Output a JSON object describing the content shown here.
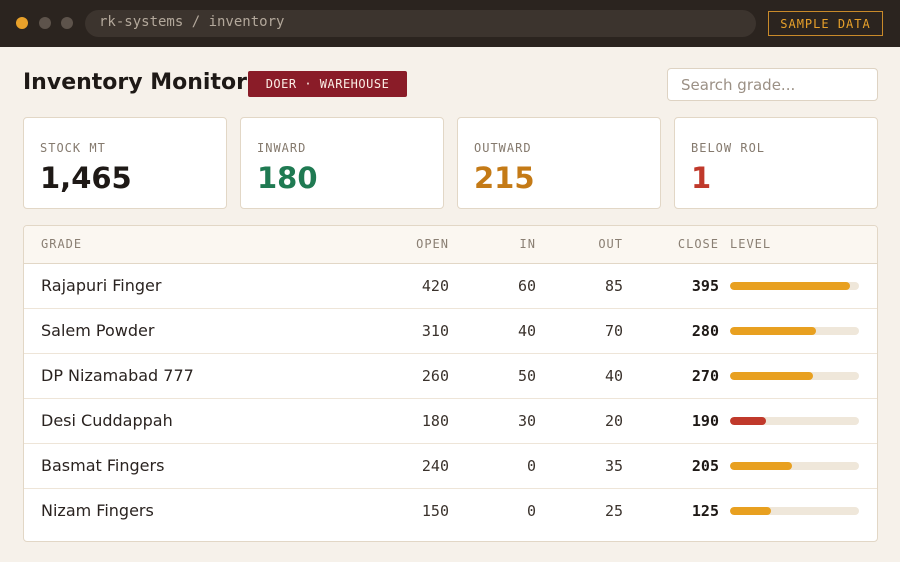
{
  "browser": {
    "address": "rk-systems / inventory",
    "sample_label": "SAMPLE DATA"
  },
  "header": {
    "title": "Inventory Monitor",
    "badge": "DOER · WAREHOUSE",
    "search_placeholder": "Search grade..."
  },
  "stats": [
    {
      "label": "STOCK MT",
      "value": "1,465",
      "color": "#1e1916"
    },
    {
      "label": "INWARD",
      "value": "180",
      "color": "#1f7a52"
    },
    {
      "label": "OUTWARD",
      "value": "215",
      "color": "#c47a16"
    },
    {
      "label": "BELOW ROL",
      "value": "1",
      "color": "#c0392b"
    }
  ],
  "table": {
    "columns": {
      "grade": "GRADE",
      "open": "OPEN",
      "in": "IN",
      "out": "OUT",
      "close": "CLOSE",
      "level": "LEVEL"
    },
    "colors": {
      "normal": "#e8a020",
      "low": "#c0392b"
    },
    "rows": [
      {
        "grade": "Rajapuri Finger",
        "open": "420",
        "in": "60",
        "out": "85",
        "close": "395",
        "level": 0.93,
        "low": false
      },
      {
        "grade": "Salem Powder",
        "open": "310",
        "in": "40",
        "out": "70",
        "close": "280",
        "level": 0.67,
        "low": false
      },
      {
        "grade": "DP Nizamabad 777",
        "open": "260",
        "in": "50",
        "out": "40",
        "close": "270",
        "level": 0.64,
        "low": false
      },
      {
        "grade": "Desi Cuddappah",
        "open": "180",
        "in": "30",
        "out": "20",
        "close": "190",
        "level": 0.28,
        "low": true
      },
      {
        "grade": "Basmat Fingers",
        "open": "240",
        "in": "0",
        "out": "35",
        "close": "205",
        "level": 0.48,
        "low": false
      },
      {
        "grade": "Nizam Fingers",
        "open": "150",
        "in": "0",
        "out": "25",
        "close": "125",
        "level": 0.32,
        "low": false
      }
    ]
  }
}
